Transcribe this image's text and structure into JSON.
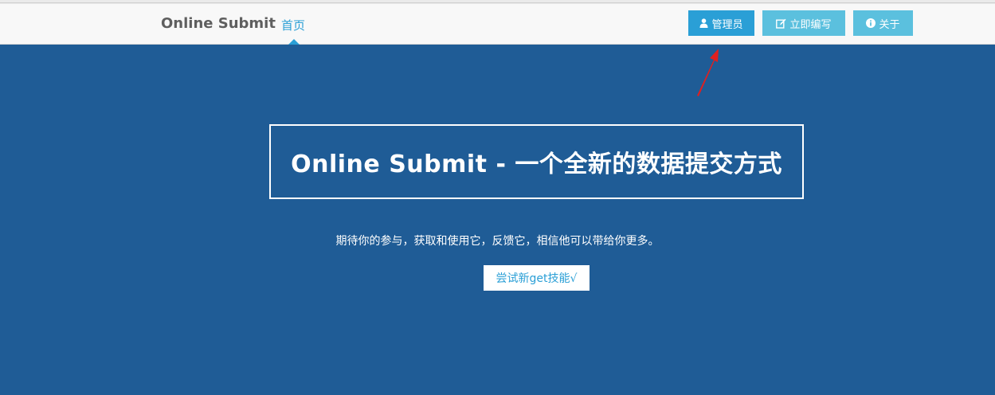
{
  "navbar": {
    "brand": "Online Submit",
    "home": "首页",
    "buttons": {
      "admin": "管理员",
      "write": "立即编写",
      "about": "关于"
    }
  },
  "hero": {
    "title": "Online Submit - 一个全新的数据提交方式",
    "subtitle": "期待你的参与，获取和使用它，反馈它，相信他可以带给你更多。",
    "cta": "尝试新get技能√"
  },
  "icons": {
    "admin": "user-icon",
    "write": "edit-icon",
    "about": "info-icon"
  },
  "colors": {
    "primary": "#2a9fd6",
    "info": "#5bc0de",
    "hero": "#1f5c96",
    "annotation": "#e02020"
  }
}
